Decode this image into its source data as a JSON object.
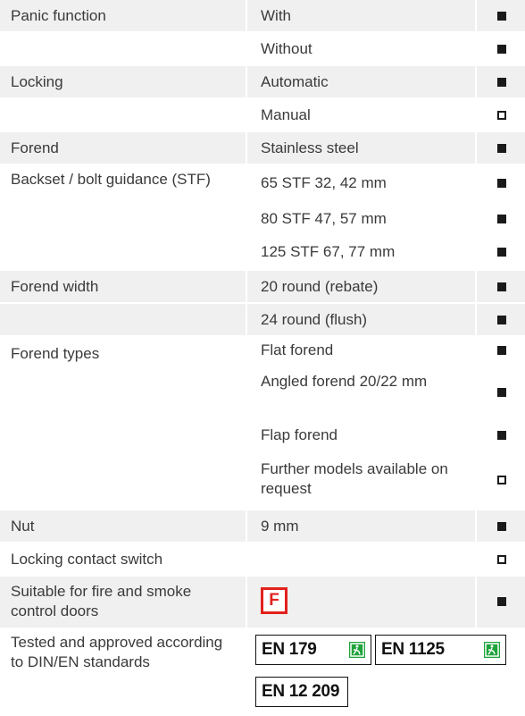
{
  "rows": [
    {
      "label": "Panic function",
      "value": "With",
      "mark": "standard"
    },
    {
      "label": "",
      "value": "Without",
      "mark": "standard"
    },
    {
      "label": "Locking",
      "value": "Automatic",
      "mark": "standard"
    },
    {
      "label": "",
      "value": "Manual",
      "mark": "optional"
    },
    {
      "label": "Forend",
      "value": "Stainless steel",
      "mark": "standard"
    },
    {
      "label": "Backset / bolt guidance (STF)",
      "value": "65 STF 32, 42 mm",
      "mark": "standard"
    },
    {
      "label": "",
      "value": "80 STF 47, 57 mm",
      "mark": "standard"
    },
    {
      "label": "",
      "value": "125 STF 67, 77 mm",
      "mark": "standard"
    },
    {
      "label": "Forend width",
      "value": "20 round (rebate)",
      "mark": "standard"
    },
    {
      "label": "",
      "value": "24 round (flush)",
      "mark": "standard"
    },
    {
      "label": "Forend types",
      "value": "Flat forend",
      "mark": "standard"
    },
    {
      "label": "",
      "value": "Angled forend 20/22 mm",
      "mark": "standard"
    },
    {
      "label": "",
      "value": "Flap forend",
      "mark": "standard"
    },
    {
      "label": "",
      "value": "Further models available on request",
      "mark": "optional"
    },
    {
      "label": "Nut",
      "value": "9 mm",
      "mark": "standard"
    },
    {
      "label": "Locking contact switch",
      "value": "",
      "mark": "optional"
    },
    {
      "label": "Suitable for fire and smoke control doors",
      "value": "",
      "mark": "standard"
    },
    {
      "label": "Tested and approved according to DIN/EN standards",
      "value": "",
      "mark": ""
    }
  ],
  "fire_badge": {
    "letter": "F",
    "color": "#e2211c"
  },
  "standards_badges": [
    "EN 179",
    "EN 1125",
    "EN 12 209"
  ],
  "exit_icon_color": "#1fa33b",
  "mark_legend": {
    "standard": "filled-square-icon",
    "optional": "hollow-square-icon"
  }
}
